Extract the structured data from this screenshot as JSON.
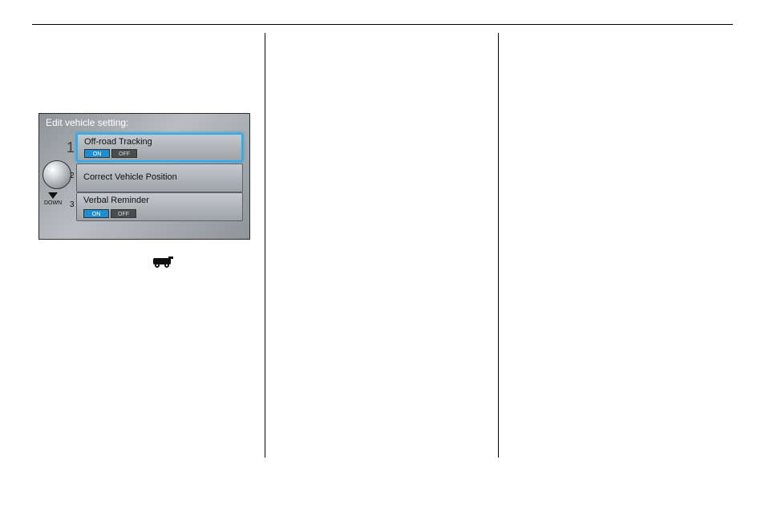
{
  "device": {
    "title": "Edit vehicle setting:",
    "rows": [
      {
        "label": "Off-road Tracking",
        "on": "ON",
        "off": "OFF"
      },
      {
        "label": "Correct Vehicle Position"
      },
      {
        "label": "Verbal Reminder",
        "on": "ON",
        "off": "OFF"
      }
    ],
    "indices": {
      "one": "1",
      "two": "2",
      "three": "3"
    },
    "down": "DOWN"
  }
}
